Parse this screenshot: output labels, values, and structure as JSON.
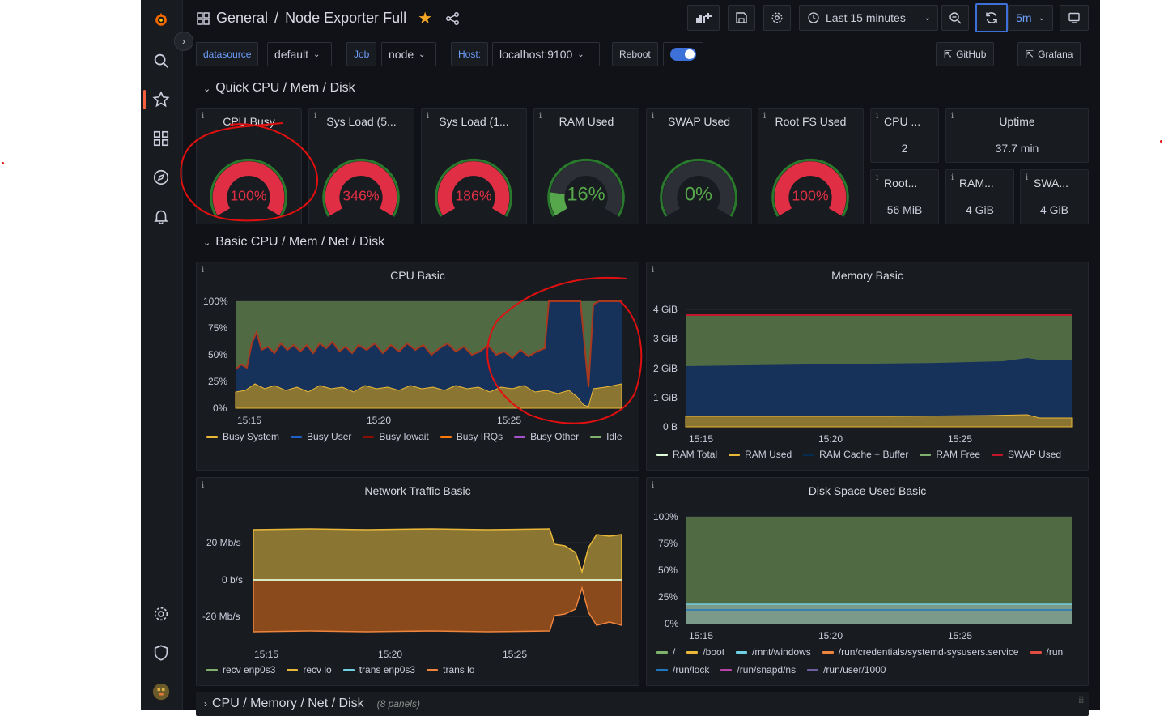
{
  "breadcrumb": {
    "folder": "General",
    "separator": "/",
    "dashboard": "Node Exporter Full"
  },
  "timepicker": {
    "range": "Last 15 minutes",
    "refresh_interval": "5m"
  },
  "variables": [
    {
      "label": "datasource",
      "value": "default"
    },
    {
      "label": "Job",
      "value": "node"
    },
    {
      "label": "Host:",
      "value": "localhost:9100"
    },
    {
      "label": "Reboot",
      "toggle": true
    }
  ],
  "links": {
    "github": "GitHub",
    "grafana": "Grafana"
  },
  "rows": {
    "quick": "Quick CPU / Mem / Disk",
    "basic": "Basic CPU / Mem / Net / Disk",
    "collapsed": "CPU / Memory / Net / Disk",
    "collapsed_note": "(8 panels)"
  },
  "gauges": [
    {
      "title": "CPU Busy",
      "value": "100%",
      "fill": 1.0,
      "color": "#e02f44"
    },
    {
      "title": "Sys Load (5...",
      "value": "346%",
      "fill": 1.0,
      "color": "#e02f44"
    },
    {
      "title": "Sys Load (1...",
      "value": "186%",
      "fill": 1.0,
      "color": "#e02f44"
    },
    {
      "title": "RAM Used",
      "value": "16%",
      "fill": 0.16,
      "color": "#56a64b"
    },
    {
      "title": "SWAP Used",
      "value": "0%",
      "fill": 0.0,
      "color": "#56a64b"
    },
    {
      "title": "Root FS Used",
      "value": "100%",
      "fill": 1.0,
      "color": "#e02f44"
    }
  ],
  "stats": [
    {
      "title": "CPU ...",
      "value": "2"
    },
    {
      "title": "Uptime",
      "value": "37.7 min"
    },
    {
      "title": "Root...",
      "value": "56 MiB"
    },
    {
      "title": "RAM...",
      "value": "4 GiB"
    },
    {
      "title": "SWA...",
      "value": "4 GiB"
    }
  ],
  "panels": {
    "cpu": {
      "title": "CPU Basic",
      "legend": [
        {
          "n": "Busy System",
          "c": "#eab839"
        },
        {
          "n": "Busy User",
          "c": "#1f60c4"
        },
        {
          "n": "Busy Iowait",
          "c": "#890f02"
        },
        {
          "n": "Busy IRQs",
          "c": "#ff780a"
        },
        {
          "n": "Busy Other",
          "c": "#a352cc"
        },
        {
          "n": "Idle",
          "c": "#7eb26d"
        }
      ]
    },
    "mem": {
      "title": "Memory Basic",
      "legend": [
        {
          "n": "RAM Total",
          "c": "#e0f9d7"
        },
        {
          "n": "RAM Used",
          "c": "#eab839"
        },
        {
          "n": "RAM Cache + Buffer",
          "c": "#052b51"
        },
        {
          "n": "RAM Free",
          "c": "#7eb26d"
        },
        {
          "n": "SWAP Used",
          "c": "#c4162a"
        }
      ]
    },
    "net": {
      "title": "Network Traffic Basic",
      "legend": [
        {
          "n": "recv enp0s3",
          "c": "#7eb26d"
        },
        {
          "n": "recv lo",
          "c": "#eab839"
        },
        {
          "n": "trans enp0s3",
          "c": "#6ed0e0"
        },
        {
          "n": "trans lo",
          "c": "#ef843c"
        }
      ]
    },
    "disk": {
      "title": "Disk Space Used Basic",
      "legend": [
        {
          "n": "/",
          "c": "#7eb26d"
        },
        {
          "n": "/boot",
          "c": "#eab839"
        },
        {
          "n": "/mnt/windows",
          "c": "#6ed0e0"
        },
        {
          "n": "/run/credentials/systemd-sysusers.service",
          "c": "#ef843c"
        },
        {
          "n": "/run",
          "c": "#e24d42"
        },
        {
          "n": "/run/lock",
          "c": "#1f78c1"
        },
        {
          "n": "/run/snapd/ns",
          "c": "#ba43a9"
        },
        {
          "n": "/run/user/1000",
          "c": "#705da0"
        }
      ]
    }
  },
  "chart_data": [
    {
      "type": "area",
      "title": "CPU Basic",
      "x": [
        "15:15",
        "15:20",
        "15:25"
      ],
      "yticks": [
        "100%",
        "75%",
        "50%",
        "25%",
        "0%"
      ],
      "ylim": [
        0,
        100
      ],
      "series": [
        {
          "name": "Busy System",
          "values": [
            20,
            22,
            21,
            20,
            22,
            21,
            22,
            21,
            20,
            20,
            22,
            5,
            22
          ]
        },
        {
          "name": "Busy User",
          "values": [
            20,
            30,
            33,
            32,
            34,
            30,
            30,
            30,
            32,
            27,
            35,
            40,
            78
          ]
        },
        {
          "name": "Busy Iowait",
          "values": [
            0,
            1,
            1,
            1,
            1,
            1,
            1,
            1,
            1,
            1,
            1,
            1,
            1
          ]
        },
        {
          "name": "Idle",
          "values": [
            60,
            47,
            45,
            47,
            43,
            48,
            47,
            48,
            47,
            52,
            42,
            54,
            0
          ]
        }
      ]
    },
    {
      "type": "area",
      "title": "Memory Basic",
      "x": [
        "15:15",
        "15:20",
        "15:25"
      ],
      "yticks": [
        "4 GiB",
        "3 GiB",
        "2 GiB",
        "1 GiB",
        "0 B"
      ],
      "ylim": [
        0,
        4
      ]
    },
    {
      "type": "area",
      "title": "Network Traffic Basic",
      "x": [
        "15:15",
        "15:20",
        "15:25"
      ],
      "yticks": [
        "20 Mb/s",
        "0 b/s",
        "-20 Mb/s"
      ]
    },
    {
      "type": "area",
      "title": "Disk Space Used Basic",
      "x": [
        "15:15",
        "15:20",
        "15:25"
      ],
      "yticks": [
        "100%",
        "75%",
        "50%",
        "25%",
        "0%"
      ],
      "ylim": [
        0,
        100
      ]
    }
  ]
}
